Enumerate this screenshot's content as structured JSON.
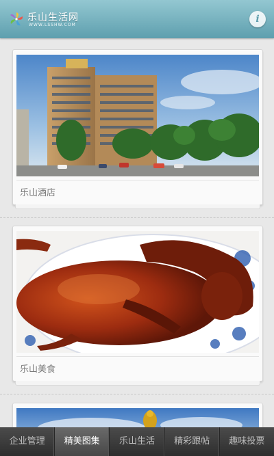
{
  "header": {
    "logo_title": "乐山生活网",
    "logo_sub": "WWW.LSSHW.COM",
    "info_icon": "i"
  },
  "feed": {
    "items": [
      {
        "caption": "乐山酒店",
        "photo": "hotel-photo"
      },
      {
        "caption": "乐山美食",
        "photo": "roast-duck-photo"
      },
      {
        "caption": "",
        "photo": "landscape-photo"
      }
    ]
  },
  "tabs": [
    {
      "label": "企业管理",
      "active": false
    },
    {
      "label": "精美图集",
      "active": true
    },
    {
      "label": "乐山生活",
      "active": false
    },
    {
      "label": "精彩跟帖",
      "active": false
    },
    {
      "label": "趣味投票",
      "active": false
    }
  ],
  "colors": {
    "header": "#6fa9b7",
    "tabbar": "#3a3a3a",
    "tab_active": "#575757",
    "background": "#e8e8e8"
  }
}
